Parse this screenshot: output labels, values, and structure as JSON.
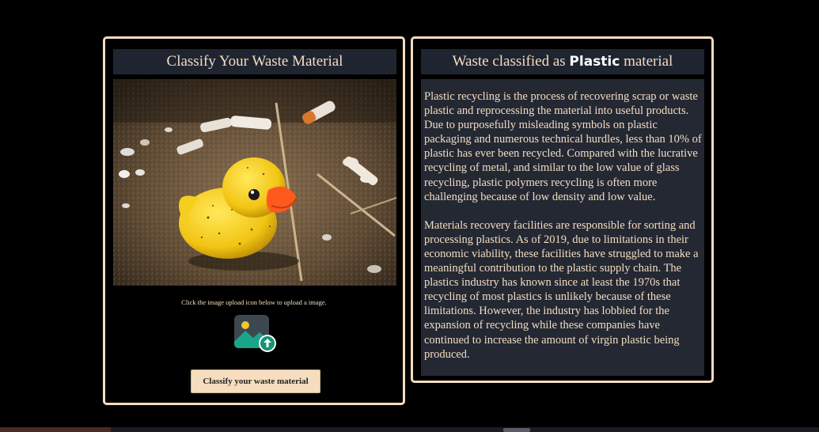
{
  "left": {
    "title": "Classify Your Waste Material",
    "upload_hint": "Click the image upload icon below to upload a image.",
    "upload_icon": "image-upload-icon",
    "classify_button": "Classify your waste material"
  },
  "right": {
    "title_prefix": "Waste classified as",
    "title_class": "Plastic",
    "title_suffix": "material",
    "paragraphs": [
      "Plastic recycling is the process of recovering scrap or waste plastic and reprocessing the material into useful products. Due to purposefully misleading symbols on plastic packaging and numerous technical hurdles, less than 10% of plastic has ever been recycled. Compared with the lucrative recycling of metal, and similar to the low value of glass recycling, plastic polymers recycling is often more challenging because of low density and low value.",
      "Materials recovery facilities are responsible for sorting and processing plastics. As of 2019, due to limitations in their economic viability, these facilities have struggled to make a meaningful contribution to the plastic supply chain. The plastics industry has known since at least the 1970s that recycling of most plastics is unlikely because of these limitations. However, the industry has lobbied for the expansion of recycling while these companies have continued to increase the amount of virgin plastic being produced."
    ]
  },
  "colors": {
    "accent": "#f3dcc0",
    "title_bg": "#1f2530",
    "info_bg": "#232833",
    "button_bg": "#f6ddbf",
    "upload_green": "#1aa58a"
  }
}
